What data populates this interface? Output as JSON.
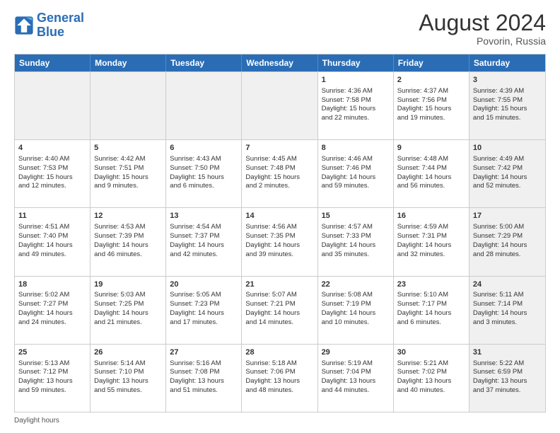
{
  "header": {
    "logo_general": "General",
    "logo_blue": "Blue",
    "month_title": "August 2024",
    "location": "Povorin, Russia"
  },
  "weekdays": [
    "Sunday",
    "Monday",
    "Tuesday",
    "Wednesday",
    "Thursday",
    "Friday",
    "Saturday"
  ],
  "footer": {
    "daylight_label": "Daylight hours"
  },
  "rows": [
    [
      {
        "day": "",
        "info": "",
        "shaded": true
      },
      {
        "day": "",
        "info": "",
        "shaded": true
      },
      {
        "day": "",
        "info": "",
        "shaded": true
      },
      {
        "day": "",
        "info": "",
        "shaded": true
      },
      {
        "day": "1",
        "info": "Sunrise: 4:36 AM\nSunset: 7:58 PM\nDaylight: 15 hours\nand 22 minutes.",
        "shaded": false
      },
      {
        "day": "2",
        "info": "Sunrise: 4:37 AM\nSunset: 7:56 PM\nDaylight: 15 hours\nand 19 minutes.",
        "shaded": false
      },
      {
        "day": "3",
        "info": "Sunrise: 4:39 AM\nSunset: 7:55 PM\nDaylight: 15 hours\nand 15 minutes.",
        "shaded": true
      }
    ],
    [
      {
        "day": "4",
        "info": "Sunrise: 4:40 AM\nSunset: 7:53 PM\nDaylight: 15 hours\nand 12 minutes.",
        "shaded": false
      },
      {
        "day": "5",
        "info": "Sunrise: 4:42 AM\nSunset: 7:51 PM\nDaylight: 15 hours\nand 9 minutes.",
        "shaded": false
      },
      {
        "day": "6",
        "info": "Sunrise: 4:43 AM\nSunset: 7:50 PM\nDaylight: 15 hours\nand 6 minutes.",
        "shaded": false
      },
      {
        "day": "7",
        "info": "Sunrise: 4:45 AM\nSunset: 7:48 PM\nDaylight: 15 hours\nand 2 minutes.",
        "shaded": false
      },
      {
        "day": "8",
        "info": "Sunrise: 4:46 AM\nSunset: 7:46 PM\nDaylight: 14 hours\nand 59 minutes.",
        "shaded": false
      },
      {
        "day": "9",
        "info": "Sunrise: 4:48 AM\nSunset: 7:44 PM\nDaylight: 14 hours\nand 56 minutes.",
        "shaded": false
      },
      {
        "day": "10",
        "info": "Sunrise: 4:49 AM\nSunset: 7:42 PM\nDaylight: 14 hours\nand 52 minutes.",
        "shaded": true
      }
    ],
    [
      {
        "day": "11",
        "info": "Sunrise: 4:51 AM\nSunset: 7:40 PM\nDaylight: 14 hours\nand 49 minutes.",
        "shaded": false
      },
      {
        "day": "12",
        "info": "Sunrise: 4:53 AM\nSunset: 7:39 PM\nDaylight: 14 hours\nand 46 minutes.",
        "shaded": false
      },
      {
        "day": "13",
        "info": "Sunrise: 4:54 AM\nSunset: 7:37 PM\nDaylight: 14 hours\nand 42 minutes.",
        "shaded": false
      },
      {
        "day": "14",
        "info": "Sunrise: 4:56 AM\nSunset: 7:35 PM\nDaylight: 14 hours\nand 39 minutes.",
        "shaded": false
      },
      {
        "day": "15",
        "info": "Sunrise: 4:57 AM\nSunset: 7:33 PM\nDaylight: 14 hours\nand 35 minutes.",
        "shaded": false
      },
      {
        "day": "16",
        "info": "Sunrise: 4:59 AM\nSunset: 7:31 PM\nDaylight: 14 hours\nand 32 minutes.",
        "shaded": false
      },
      {
        "day": "17",
        "info": "Sunrise: 5:00 AM\nSunset: 7:29 PM\nDaylight: 14 hours\nand 28 minutes.",
        "shaded": true
      }
    ],
    [
      {
        "day": "18",
        "info": "Sunrise: 5:02 AM\nSunset: 7:27 PM\nDaylight: 14 hours\nand 24 minutes.",
        "shaded": false
      },
      {
        "day": "19",
        "info": "Sunrise: 5:03 AM\nSunset: 7:25 PM\nDaylight: 14 hours\nand 21 minutes.",
        "shaded": false
      },
      {
        "day": "20",
        "info": "Sunrise: 5:05 AM\nSunset: 7:23 PM\nDaylight: 14 hours\nand 17 minutes.",
        "shaded": false
      },
      {
        "day": "21",
        "info": "Sunrise: 5:07 AM\nSunset: 7:21 PM\nDaylight: 14 hours\nand 14 minutes.",
        "shaded": false
      },
      {
        "day": "22",
        "info": "Sunrise: 5:08 AM\nSunset: 7:19 PM\nDaylight: 14 hours\nand 10 minutes.",
        "shaded": false
      },
      {
        "day": "23",
        "info": "Sunrise: 5:10 AM\nSunset: 7:17 PM\nDaylight: 14 hours\nand 6 minutes.",
        "shaded": false
      },
      {
        "day": "24",
        "info": "Sunrise: 5:11 AM\nSunset: 7:14 PM\nDaylight: 14 hours\nand 3 minutes.",
        "shaded": true
      }
    ],
    [
      {
        "day": "25",
        "info": "Sunrise: 5:13 AM\nSunset: 7:12 PM\nDaylight: 13 hours\nand 59 minutes.",
        "shaded": false
      },
      {
        "day": "26",
        "info": "Sunrise: 5:14 AM\nSunset: 7:10 PM\nDaylight: 13 hours\nand 55 minutes.",
        "shaded": false
      },
      {
        "day": "27",
        "info": "Sunrise: 5:16 AM\nSunset: 7:08 PM\nDaylight: 13 hours\nand 51 minutes.",
        "shaded": false
      },
      {
        "day": "28",
        "info": "Sunrise: 5:18 AM\nSunset: 7:06 PM\nDaylight: 13 hours\nand 48 minutes.",
        "shaded": false
      },
      {
        "day": "29",
        "info": "Sunrise: 5:19 AM\nSunset: 7:04 PM\nDaylight: 13 hours\nand 44 minutes.",
        "shaded": false
      },
      {
        "day": "30",
        "info": "Sunrise: 5:21 AM\nSunset: 7:02 PM\nDaylight: 13 hours\nand 40 minutes.",
        "shaded": false
      },
      {
        "day": "31",
        "info": "Sunrise: 5:22 AM\nSunset: 6:59 PM\nDaylight: 13 hours\nand 37 minutes.",
        "shaded": true
      }
    ]
  ]
}
